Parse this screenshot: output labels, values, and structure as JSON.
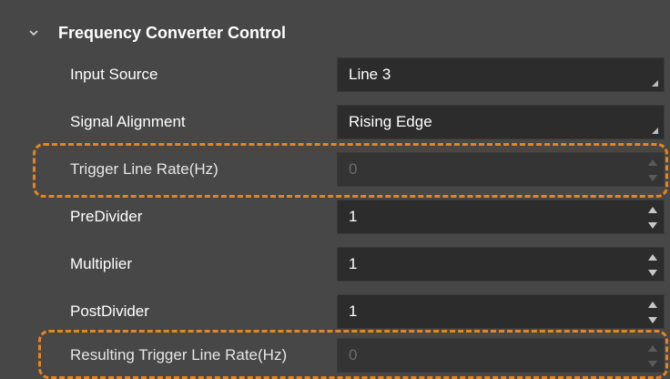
{
  "section": {
    "title": "Frequency Converter Control",
    "icon": "chevron-down-icon"
  },
  "properties": [
    {
      "label": "Input Source",
      "value": "Line 3",
      "control": "combo",
      "enabled": true
    },
    {
      "label": "Signal Alignment",
      "value": "Rising Edge",
      "control": "combo",
      "enabled": true
    },
    {
      "label": "Trigger Line Rate(Hz)",
      "value": "0",
      "control": "spin",
      "enabled": false,
      "highlighted": true
    },
    {
      "label": "PreDivider",
      "value": "1",
      "control": "spin",
      "enabled": true
    },
    {
      "label": "Multiplier",
      "value": "1",
      "control": "spin",
      "enabled": true
    },
    {
      "label": "PostDivider",
      "value": "1",
      "control": "spin",
      "enabled": true
    },
    {
      "label": "Resulting Trigger Line Rate(Hz)",
      "value": "0",
      "control": "spin",
      "enabled": false,
      "highlighted": true
    }
  ],
  "colors": {
    "highlight": "#e8841f",
    "background": "#474747",
    "field": "#2c2c2c"
  }
}
